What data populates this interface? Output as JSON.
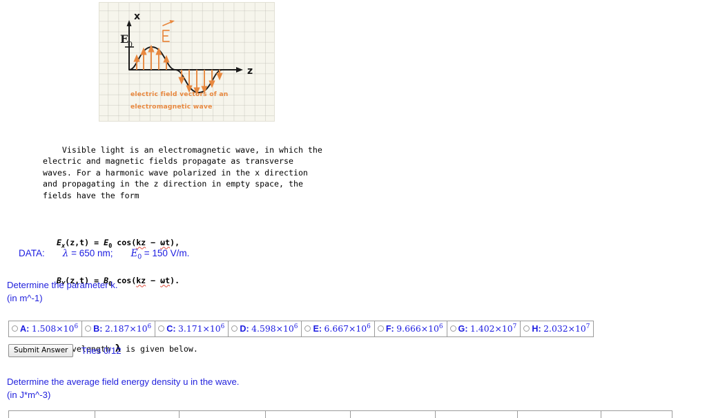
{
  "figure": {
    "axis_x_label": "x",
    "axis_z_label": "z",
    "amplitude_label": "E",
    "amplitude_sub": "0",
    "field_vector_label": "E",
    "caption_line1": "electric field vectors of an",
    "caption_line2": "electromagnetic wave",
    "colors": {
      "arrow": "#e8883f",
      "curve": "#1a1a1a",
      "paper": "#f6f5ec",
      "grid": "#d8d7c8"
    }
  },
  "problem": {
    "paragraph": "Visible light is an electromagnetic wave, in which the\nelectric and magnetic fields propagate as transverse\nwaves. For a harmonic wave polarized in the x direction\nand propagating in the z direction in empty space, the\nfields have the form",
    "equation_1": {
      "lhs_sym": "E",
      "lhs_sub": "x",
      "lhs_args": "(z,t)",
      "eq": "=",
      "amp_sym": "E",
      "amp_sub": "0",
      "rhs_fn": "cos(",
      "rhs_kz": "kz",
      "rhs_minus": "−",
      "rhs_wt": "ωt",
      "rhs_close": "),"
    },
    "equation_2": {
      "lhs_sym": "B",
      "lhs_sub": "Y",
      "lhs_args": "(z,t)",
      "eq": "=",
      "amp_sym": "B",
      "amp_sub": "0",
      "rhs_fn": "cos(",
      "rhs_kz": "kz",
      "rhs_minus": "−",
      "rhs_wt": "ωt",
      "rhs_close": ")."
    },
    "tail_before": "The wavelength ",
    "tail_symbol": "λ",
    "tail_after": " is given below."
  },
  "data": {
    "label": "DATA:",
    "lambda_sym": "λ",
    "lambda_value": " = 650 nm;",
    "e0_sym": "E",
    "e0_sub": "0",
    "e0_value": " = 150 V/m."
  },
  "question_1": {
    "text": "Determine the parameter k.",
    "units": "(in m^-1)",
    "options": [
      {
        "letter": "A",
        "mantissa": "1.508×10",
        "exponent": "6"
      },
      {
        "letter": "B",
        "mantissa": "2.187×10",
        "exponent": "6"
      },
      {
        "letter": "C",
        "mantissa": "3.171×10",
        "exponent": "6"
      },
      {
        "letter": "D",
        "mantissa": "4.598×10",
        "exponent": "6"
      },
      {
        "letter": "E",
        "mantissa": "6.667×10",
        "exponent": "6"
      },
      {
        "letter": "F",
        "mantissa": "9.666×10",
        "exponent": "6"
      },
      {
        "letter": "G",
        "mantissa": "1.402×10",
        "exponent": "7"
      },
      {
        "letter": "H",
        "mantissa": "2.032×10",
        "exponent": "7"
      }
    ],
    "submit_label": "Submit Answer",
    "tries_label": "Tries 0/12"
  },
  "question_2": {
    "text": "Determine the average field energy density u in the wave.",
    "units": "(in J*m^-3)",
    "options": [
      {
        "letter": "",
        "mantissa": "",
        "exponent": ""
      },
      {
        "letter": "",
        "mantissa": "",
        "exponent": ""
      },
      {
        "letter": "",
        "mantissa": "",
        "exponent": ""
      },
      {
        "letter": "",
        "mantissa": "",
        "exponent": ""
      },
      {
        "letter": "",
        "mantissa": "",
        "exponent": ""
      },
      {
        "letter": "",
        "mantissa": "",
        "exponent": ""
      },
      {
        "letter": "",
        "mantissa": "",
        "exponent": ""
      },
      {
        "letter": "",
        "mantissa": "",
        "exponent": ""
      }
    ]
  },
  "colors": {
    "link_blue": "#2222dd",
    "value_blue": "#1a1ae0",
    "orange": "#e8883f"
  }
}
